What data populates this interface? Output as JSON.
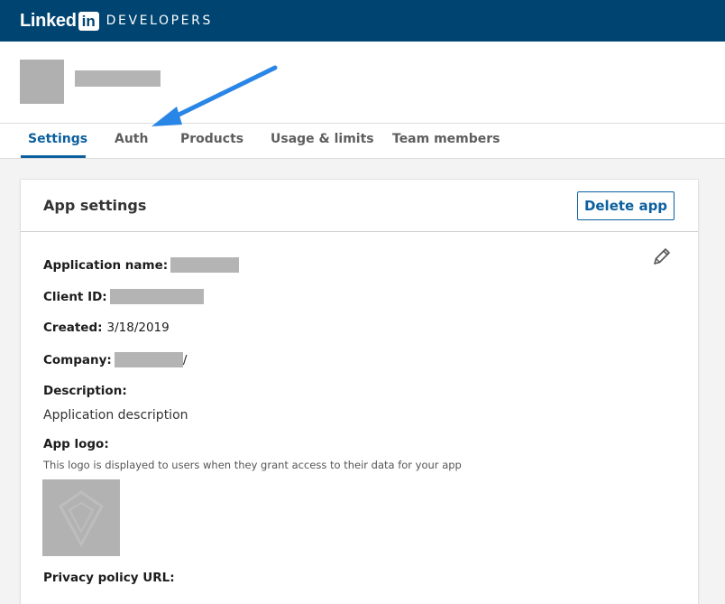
{
  "brand": {
    "logo_word": "Linked",
    "logo_box": "in",
    "product": "DEVELOPERS"
  },
  "tabs": [
    {
      "label": "Settings",
      "active": true
    },
    {
      "label": "Auth",
      "active": false
    },
    {
      "label": "Products",
      "active": false
    },
    {
      "label": "Usage & limits",
      "active": false
    },
    {
      "label": "Team members",
      "active": false
    }
  ],
  "card": {
    "title": "App settings",
    "delete_label": "Delete app",
    "fields": {
      "application_name_label": "Application name:",
      "client_id_label": "Client ID:",
      "created_label": "Created:",
      "created_value": "3/18/2019",
      "company_label": "Company:",
      "company_suffix": "/",
      "description_label": "Description:",
      "description_value": "Application description",
      "app_logo_label": "App logo:",
      "app_logo_help": "This logo is displayed to users when they grant access to their data for your app",
      "privacy_label": "Privacy policy URL:"
    }
  },
  "colors": {
    "topbar": "#004471",
    "accent": "#0b5f9e",
    "arrow": "#2a86e6"
  },
  "icons": [
    "edit-pencil-icon",
    "annotation-arrow"
  ]
}
